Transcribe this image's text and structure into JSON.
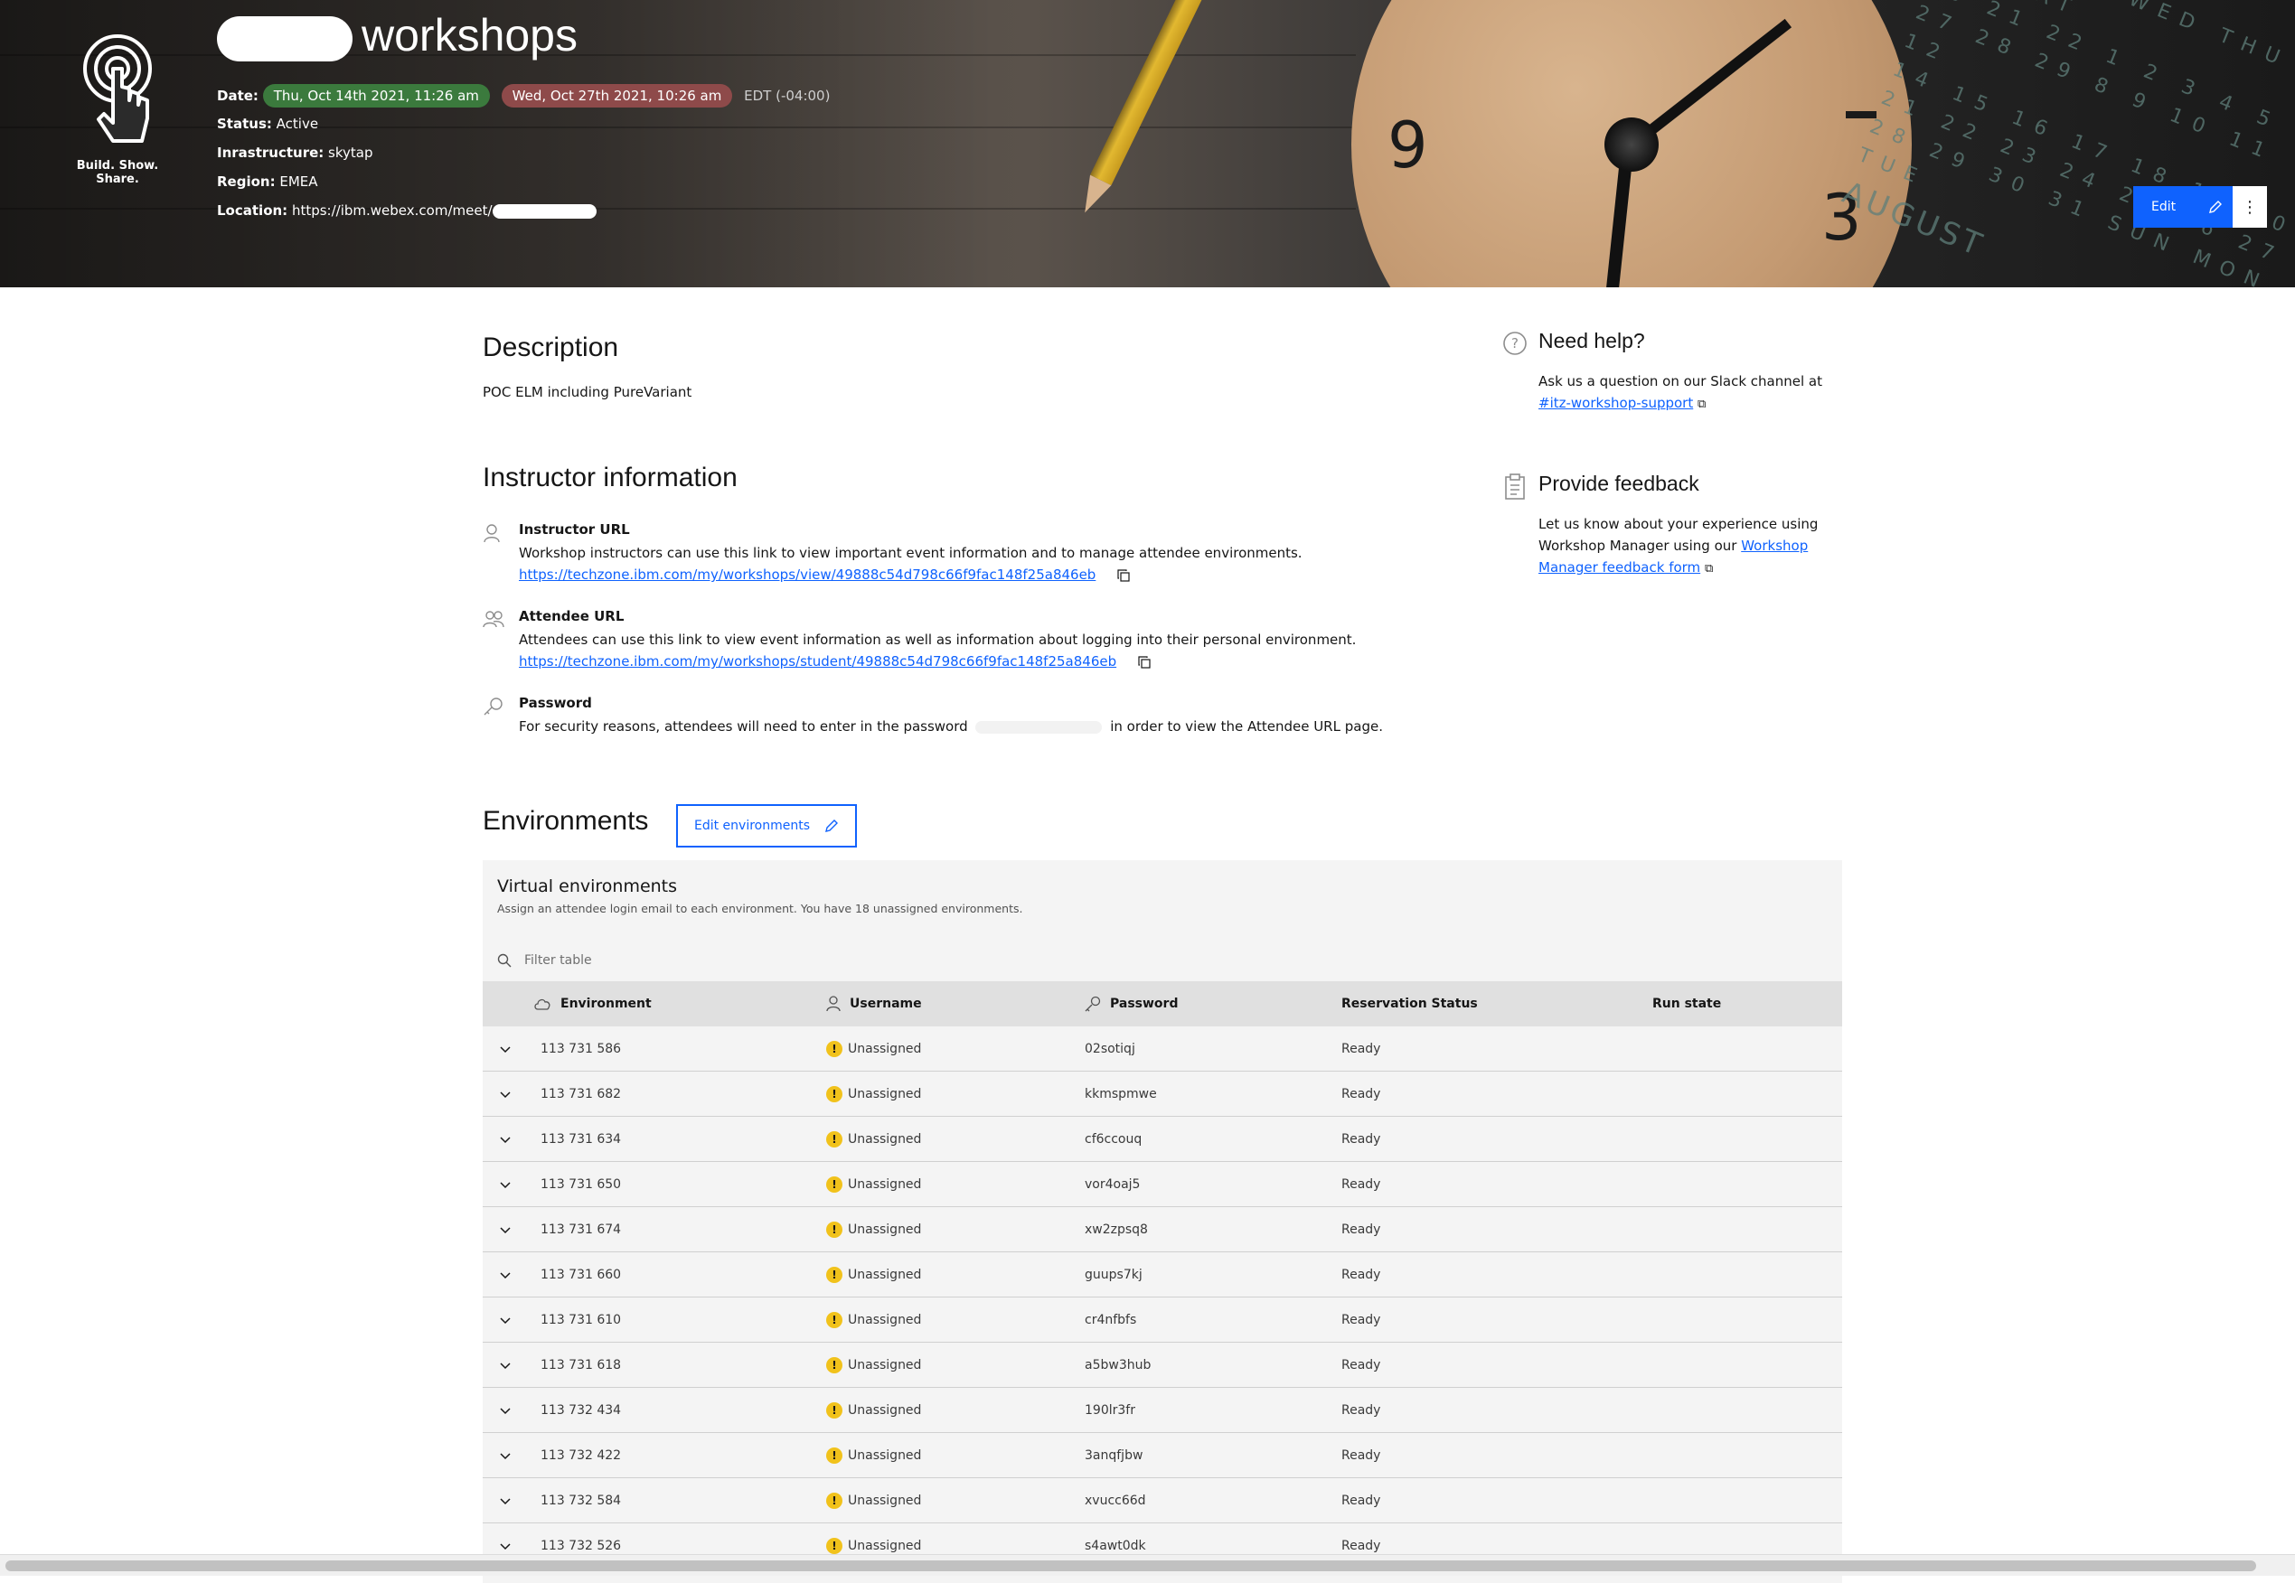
{
  "hero": {
    "title_suffix": "workshops",
    "logo_tagline": "Build. Show. Share.",
    "date_label": "Date:",
    "start_date": "Thu, Oct 14th 2021, 11:26 am",
    "end_date": "Wed, Oct 27th 2021, 10:26 am",
    "timezone": "EDT (-04:00)",
    "status_label": "Status:",
    "status_value": "Active",
    "infrastructure_label": "Inrastructure:",
    "infrastructure_value": "skytap",
    "region_label": "Region:",
    "region_value": "EMEA",
    "location_label": "Location:",
    "location_value": "https://ibm.webex.com/meet/",
    "edit_label": "Edit",
    "clock_numbers": [
      "9",
      "3"
    ],
    "calendar_month": "AUGUST"
  },
  "description": {
    "heading": "Description",
    "text": "POC ELM including PureVariant"
  },
  "instructor": {
    "heading": "Instructor information",
    "items": [
      {
        "label": "Instructor URL",
        "text": "Workshop instructors can use this link to view important event information and to manage attendee environments.",
        "url": "https://techzone.ibm.com/my/workshops/view/49888c54d798c66f9fac148f25a846eb"
      },
      {
        "label": "Attendee URL",
        "text": "Attendees can use this link to view event information as well as information about logging into their personal environment.",
        "url": "https://techzone.ibm.com/my/workshops/student/49888c54d798c66f9fac148f25a846eb"
      },
      {
        "label": "Password",
        "text_before": "For security reasons, attendees will need to enter in the password",
        "text_after": "in order to view the Attendee URL page."
      }
    ]
  },
  "help": {
    "heading": "Need help?",
    "text": "Ask us a question on our Slack channel at",
    "link": "#itz-workshop-support"
  },
  "feedback": {
    "heading": "Provide feedback",
    "text": "Let us know about your experience using Workshop Manager using our",
    "link_line1": "Workshop",
    "link_line2": "Manager feedback form"
  },
  "environments": {
    "heading": "Environments",
    "edit_button": "Edit environments",
    "table_title": "Virtual environments",
    "table_subtitle": "Assign an attendee login email to each environment. You have 18 unassigned environments.",
    "filter_placeholder": "Filter table",
    "columns": [
      "Environment",
      "Username",
      "Password",
      "Reservation Status",
      "Run state"
    ],
    "rows": [
      {
        "env": "113 731 586",
        "user": "Unassigned",
        "pass": "02sotiqj",
        "status": "Ready"
      },
      {
        "env": "113 731 682",
        "user": "Unassigned",
        "pass": "kkmspmwe",
        "status": "Ready"
      },
      {
        "env": "113 731 634",
        "user": "Unassigned",
        "pass": "cf6ccouq",
        "status": "Ready"
      },
      {
        "env": "113 731 650",
        "user": "Unassigned",
        "pass": "vor4oaj5",
        "status": "Ready"
      },
      {
        "env": "113 731 674",
        "user": "Unassigned",
        "pass": "xw2zpsq8",
        "status": "Ready"
      },
      {
        "env": "113 731 660",
        "user": "Unassigned",
        "pass": "guups7kj",
        "status": "Ready"
      },
      {
        "env": "113 731 610",
        "user": "Unassigned",
        "pass": "cr4nfbfs",
        "status": "Ready"
      },
      {
        "env": "113 731 618",
        "user": "Unassigned",
        "pass": "a5bw3hub",
        "status": "Ready"
      },
      {
        "env": "113 732 434",
        "user": "Unassigned",
        "pass": "190lr3fr",
        "status": "Ready"
      },
      {
        "env": "113 732 422",
        "user": "Unassigned",
        "pass": "3anqfjbw",
        "status": "Ready"
      },
      {
        "env": "113 732 584",
        "user": "Unassigned",
        "pass": "xvucc66d",
        "status": "Ready"
      },
      {
        "env": "113 732 526",
        "user": "Unassigned",
        "pass": "s4awt0dk",
        "status": "Ready"
      }
    ]
  },
  "colors": {
    "primary": "#0f62fe",
    "tag_green": "#3b7a3d",
    "tag_red": "#8e4a4a",
    "warning": "#f1c21b"
  }
}
